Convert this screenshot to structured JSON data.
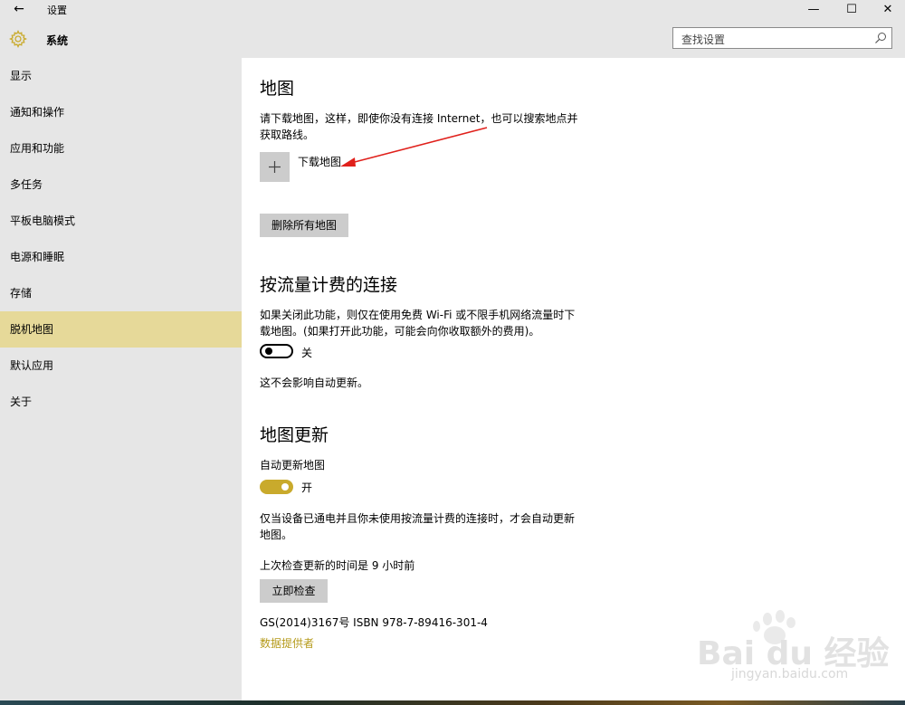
{
  "window": {
    "title": "设置",
    "back_icon": "back-arrow-icon",
    "controls": {
      "minimize": "—",
      "maximize": "☐",
      "close": "✕"
    }
  },
  "header": {
    "title": "系统",
    "icon": "gear-icon",
    "search_placeholder": "查找设置"
  },
  "sidebar": {
    "items": [
      {
        "label": "显示"
      },
      {
        "label": "通知和操作"
      },
      {
        "label": "应用和功能"
      },
      {
        "label": "多任务"
      },
      {
        "label": "平板电脑模式"
      },
      {
        "label": "电源和睡眠"
      },
      {
        "label": "存储"
      },
      {
        "label": "脱机地图",
        "selected": true
      },
      {
        "label": "默认应用"
      },
      {
        "label": "关于"
      }
    ]
  },
  "main": {
    "maps": {
      "title": "地图",
      "desc_line1": "请下载地图，这样，即使你没有连接 Internet，也可以搜索地点并",
      "desc_line2": "获取路线。",
      "download_label": "下载地图",
      "delete_all_button": "删除所有地图"
    },
    "metered": {
      "title": "按流量计费的连接",
      "desc_line1": "如果关闭此功能，则仅在使用免费 Wi-Fi 或不限手机网络流量时下",
      "desc_line2": "载地图。(如果打开此功能，可能会向你收取额外的费用)。",
      "toggle_state": "关",
      "toggle_on": false,
      "note": "这不会影响自动更新。"
    },
    "updates": {
      "title": "地图更新",
      "auto_update_label": "自动更新地图",
      "toggle_state": "开",
      "toggle_on": true,
      "desc_line1": "仅当设备已通电并且你未使用按流量计费的连接时，才会自动更新",
      "desc_line2": "地图。",
      "last_check": "上次检查更新的时间是 9 小时前",
      "check_now_button": "立即检查",
      "copyright": "GS(2014)3167号 ISBN 978-7-89416-301-4",
      "data_providers_link": "数据提供者"
    }
  },
  "watermark": {
    "brand": "Bai du 经验",
    "url": "jingyan.baidu.com"
  },
  "colors": {
    "sidebar_bg": "#e6e6e6",
    "selected_bg": "#e6d999",
    "accent": "#c9aa2c",
    "link": "#b59a1a",
    "button_bg": "#cccccc",
    "annotation_arrow": "#e0201b"
  }
}
